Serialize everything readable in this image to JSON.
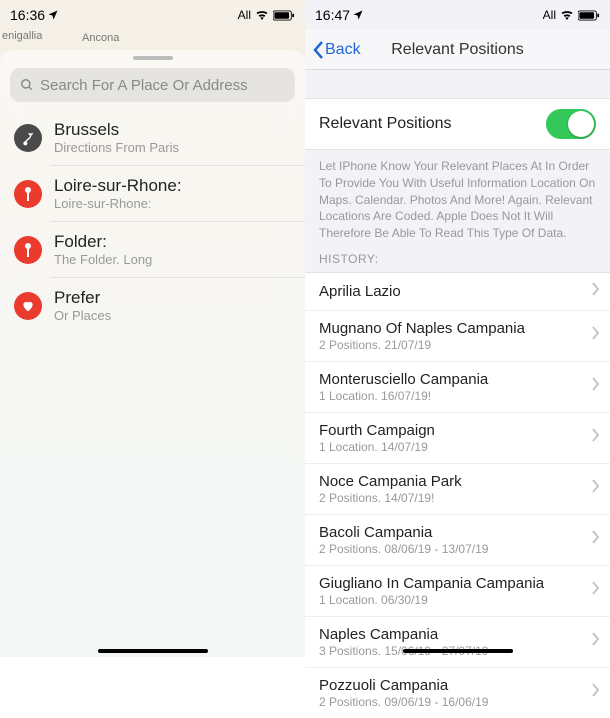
{
  "left": {
    "status": {
      "time": "16:36",
      "right_label": "All"
    },
    "map": {
      "city_left": "enigallia",
      "city_right": "Ancona"
    },
    "search": {
      "placeholder": "Search For A Place Or Address"
    },
    "items": [
      {
        "icon": "route",
        "color": "dark",
        "title": "Brussels",
        "sub": "Directions From Paris"
      },
      {
        "icon": "pin",
        "color": "red",
        "title": "Loire-sur-Rhone:",
        "sub": "Loire-sur-Rhone:"
      },
      {
        "icon": "pin",
        "color": "red",
        "title": "Folder:",
        "sub": "The Folder. Long"
      },
      {
        "icon": "heart",
        "color": "red",
        "title": "Prefer",
        "sub": "Or Places"
      }
    ]
  },
  "right": {
    "status": {
      "time": "16:47",
      "right_label": "All"
    },
    "nav": {
      "back": "Back",
      "title": "Relevant Positions"
    },
    "toggle": {
      "label": "Relevant Positions",
      "on": true
    },
    "desc": "Let IPhone Know Your Relevant Places At In Order To Provide You With Useful Information Location On Maps. Calendar. Photos And More! Again. Relevant Locations Are Coded. Apple Does Not It Will Therefore Be Able To Read This Type Of Data.",
    "history_header": "HISTORY:",
    "history": [
      {
        "title": "Aprilia Lazio",
        "sub": ""
      },
      {
        "title": "Mugnano Of Naples Campania",
        "sub": "2 Positions. 21/07/19"
      },
      {
        "title": "Monterusciello Campania",
        "sub": "1 Location. 16/07/19!"
      },
      {
        "title": "Fourth Campaign",
        "sub": "1 Location. 14/07/19"
      },
      {
        "title": "Noce Campania Park",
        "sub": "2 Positions. 14/07/19!"
      },
      {
        "title": "Bacoli Campania",
        "sub": "2 Positions. 08/06/19 - 13/07/19"
      },
      {
        "title": "Giugliano In Campania Campania",
        "sub": "1 Location. 06/30/19"
      },
      {
        "title": "Naples Campania",
        "sub": "3 Positions. 15/06/19 - 27/07/19"
      },
      {
        "title": "Pozzuoli Campania",
        "sub": "2 Positions. 09/06/19 - 16/06/19"
      }
    ]
  }
}
